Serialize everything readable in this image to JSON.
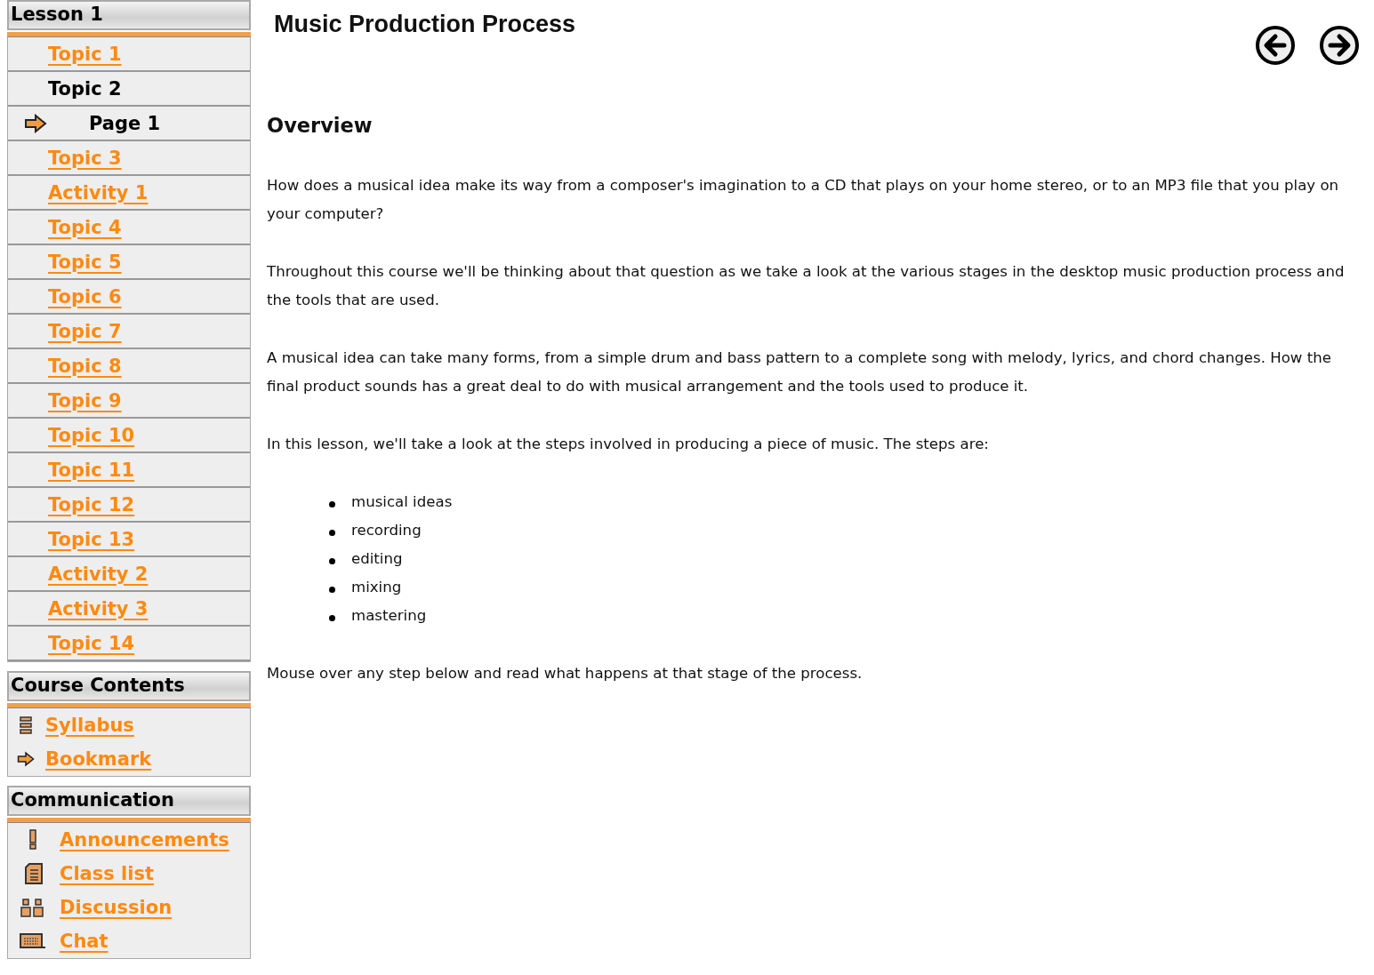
{
  "lesson": {
    "title": "Lesson 1",
    "items": [
      {
        "label": "Topic 1",
        "kind": "link"
      },
      {
        "label": "Topic 2",
        "kind": "plain"
      },
      {
        "label": "Page 1",
        "kind": "current"
      },
      {
        "label": "Topic 3",
        "kind": "link"
      },
      {
        "label": "Activity 1",
        "kind": "link"
      },
      {
        "label": "Topic 4",
        "kind": "link"
      },
      {
        "label": "Topic 5",
        "kind": "link"
      },
      {
        "label": "Topic 6",
        "kind": "link"
      },
      {
        "label": "Topic 7",
        "kind": "link"
      },
      {
        "label": "Topic 8",
        "kind": "link"
      },
      {
        "label": "Topic 9",
        "kind": "link"
      },
      {
        "label": "Topic 10",
        "kind": "link"
      },
      {
        "label": "Topic 11",
        "kind": "link"
      },
      {
        "label": "Topic 12",
        "kind": "link"
      },
      {
        "label": "Topic 13",
        "kind": "link"
      },
      {
        "label": "Activity 2",
        "kind": "link"
      },
      {
        "label": "Activity 3",
        "kind": "link"
      },
      {
        "label": "Topic 14",
        "kind": "link"
      }
    ]
  },
  "course_contents": {
    "title": "Course Contents",
    "items": [
      {
        "label": "Syllabus",
        "kind": "list"
      },
      {
        "label": "Bookmark",
        "kind": "arrow"
      }
    ]
  },
  "communication": {
    "title": "Communication",
    "items": [
      {
        "label": "Announcements",
        "kind": "alert"
      },
      {
        "label": "Class list",
        "kind": "book"
      },
      {
        "label": "Discussion",
        "kind": "people"
      },
      {
        "label": "Chat",
        "kind": "keyboard"
      }
    ]
  },
  "page": {
    "title": "Music Production Process",
    "heading": "Overview",
    "paragraphs": [
      "How does a musical idea make its way from a composer's imagination to a CD that plays on your home stereo, or to an MP3 file that you play on your computer?",
      "Throughout this course we'll be thinking about that question as we take a look at the various stages in the desktop music production process and the tools that are used.",
      "A musical idea can take many forms, from a simple drum and bass pattern to a complete song with melody, lyrics, and chord changes. How the final product sounds has a great deal to do with musical arrangement and the tools used to produce it.",
      "In this lesson, we'll take a look at the steps involved in producing a piece of music. The steps are:"
    ],
    "steps": [
      "musical ideas",
      "recording",
      "editing",
      "mixing",
      "mastering"
    ],
    "closing": "Mouse over any step below and read what happens at that stage of the process."
  }
}
